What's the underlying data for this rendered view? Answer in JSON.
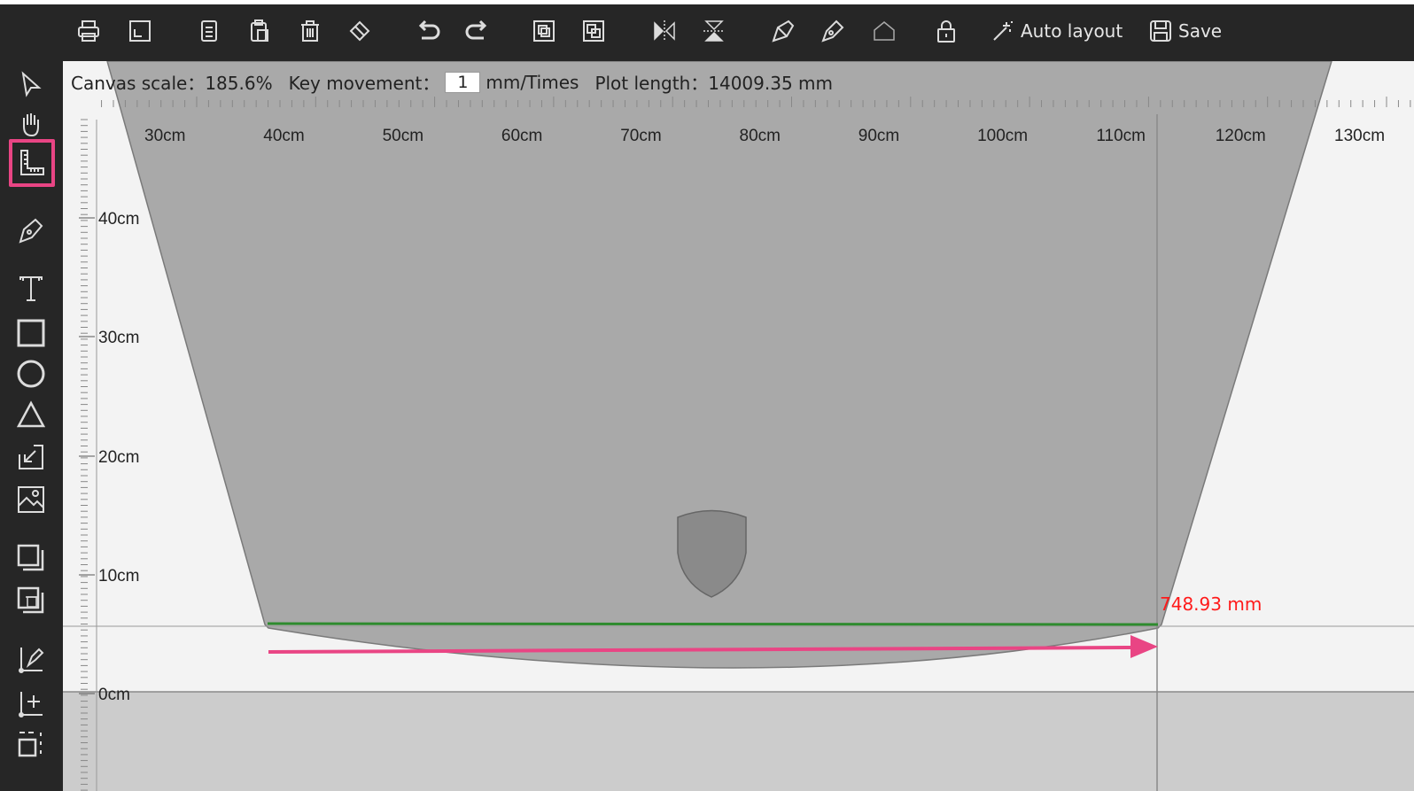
{
  "toolbar": {
    "auto_layout_label": "Auto layout",
    "save_label": "Save"
  },
  "canvas_info": {
    "scale_label": "Canvas scale：",
    "scale_value": "185.6%",
    "key_label": "Key movement：",
    "key_value": "1",
    "key_unit": "mm/Times",
    "plot_label": "Plot length：",
    "plot_value": "14009.35 mm"
  },
  "ruler": {
    "x_labels": [
      "30cm",
      "40cm",
      "50cm",
      "60cm",
      "70cm",
      "80cm",
      "90cm",
      "100cm",
      "110cm",
      "120cm",
      "130cm"
    ],
    "y_labels": [
      "40cm",
      "30cm",
      "20cm",
      "10cm",
      "0cm"
    ]
  },
  "measurement": {
    "value": "748.93 mm",
    "color": "#ff1a1a"
  },
  "colors": {
    "arrow": "#e94584",
    "guide_line": "#2e8b2e",
    "shape_fill": "#a9a9a9",
    "highlight": "#e94584"
  }
}
